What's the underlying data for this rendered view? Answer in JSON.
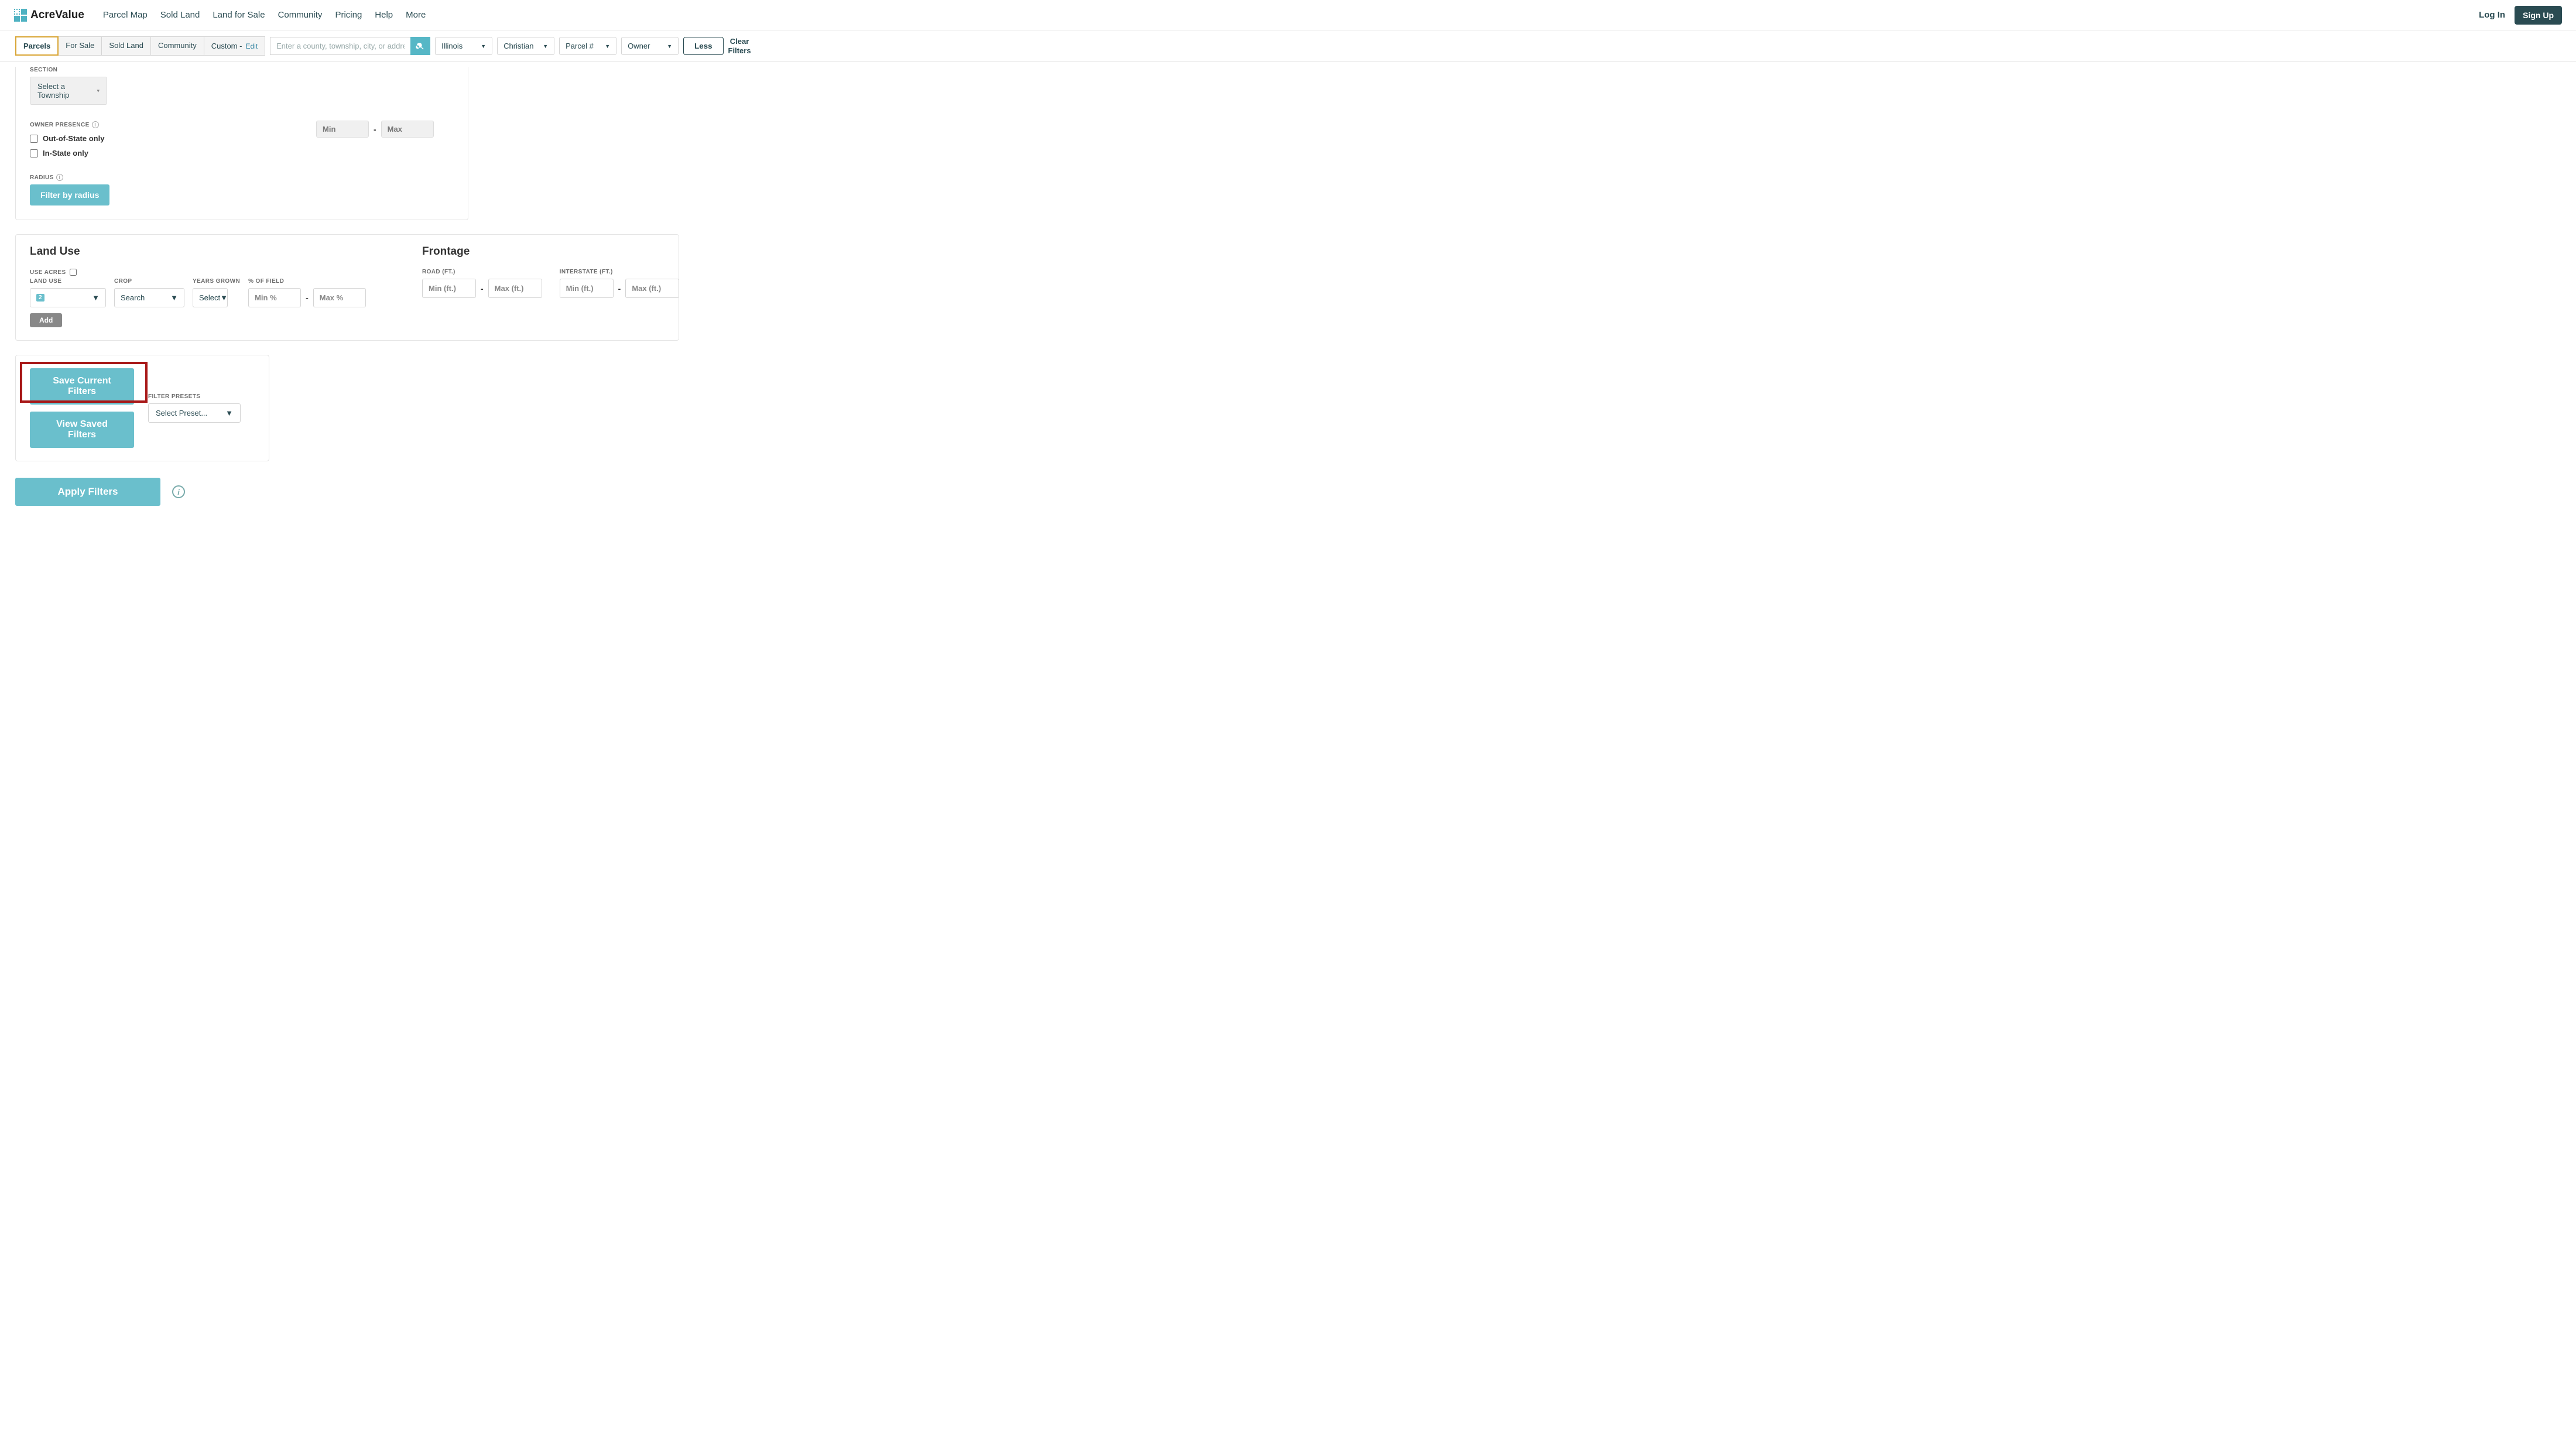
{
  "brand": {
    "name": "AcreValue"
  },
  "nav": {
    "items": [
      "Parcel Map",
      "Sold Land",
      "Land for Sale",
      "Community",
      "Pricing",
      "Help",
      "More"
    ],
    "login": "Log In",
    "signup": "Sign Up"
  },
  "filterbar": {
    "tabs": {
      "parcels": "Parcels",
      "forSale": "For Sale",
      "soldLand": "Sold Land",
      "community": "Community",
      "custom": "Custom -",
      "edit": "Edit"
    },
    "search_placeholder": "Enter a county, township, city, or address",
    "dropdowns": {
      "state": "Illinois",
      "county": "Christian",
      "parcel": "Parcel #",
      "owner": "Owner"
    },
    "less": "Less",
    "clear_line1": "Clear",
    "clear_line2": "Filters"
  },
  "topPanel": {
    "section_label": "SECTION",
    "township_select": "Select a Township",
    "min_ph": "Min",
    "max_ph": "Max",
    "owner_presence_label": "OWNER PRESENCE",
    "out_of_state": "Out-of-State only",
    "in_state": "In-State only",
    "radius_label": "RADIUS",
    "radius_btn": "Filter by radius"
  },
  "landUse": {
    "title": "Land Use",
    "use_acres_label": "USE ACRES",
    "land_use_label": "LAND USE",
    "landuse_badge": "2",
    "crop_label": "CROP",
    "crop_select": "Search",
    "years_label": "YEARS GROWN",
    "years_select": "Select",
    "pct_label": "% OF FIELD",
    "min_pct_ph": "Min %",
    "max_pct_ph": "Max %",
    "add_btn": "Add"
  },
  "frontage": {
    "title": "Frontage",
    "road_label": "ROAD (FT.)",
    "interstate_label": "INTERSTATE (FT.)",
    "min_ph": "Min (ft.)",
    "max_ph": "Max (ft.)"
  },
  "save": {
    "save_btn": "Save Current Filters",
    "view_btn": "View Saved Filters",
    "preset_label": "FILTER PRESETS",
    "preset_select": "Select Preset..."
  },
  "apply": {
    "btn": "Apply Filters"
  }
}
